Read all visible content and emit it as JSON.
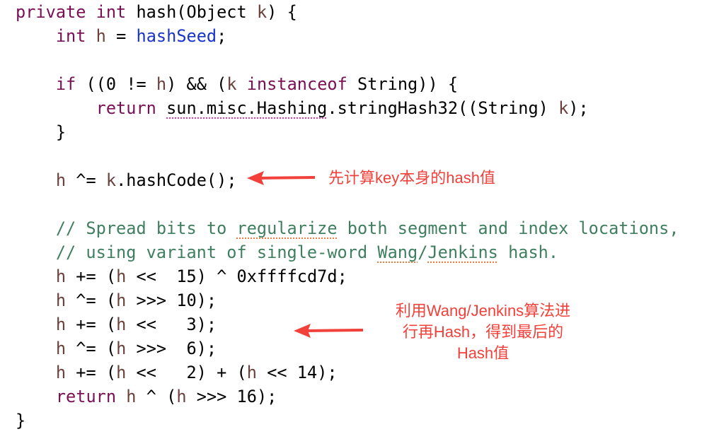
{
  "code": {
    "lines": [
      [
        {
          "t": "private int ",
          "c": "kw"
        },
        {
          "t": "hash(Object ",
          "c": ""
        },
        {
          "t": "k",
          "c": "var"
        },
        {
          "t": ") {",
          "c": ""
        }
      ],
      [
        {
          "t": "    ",
          "c": ""
        },
        {
          "t": "int ",
          "c": "kw"
        },
        {
          "t": "h",
          "c": "var"
        },
        {
          "t": " = ",
          "c": ""
        },
        {
          "t": "hashSeed",
          "c": "field"
        },
        {
          "t": ";",
          "c": ""
        }
      ],
      [],
      [
        {
          "t": "    ",
          "c": ""
        },
        {
          "t": "if ",
          "c": "kw"
        },
        {
          "t": "((0 != ",
          "c": ""
        },
        {
          "t": "h",
          "c": "var"
        },
        {
          "t": ") && (",
          "c": ""
        },
        {
          "t": "k ",
          "c": "var"
        },
        {
          "t": "instanceof ",
          "c": "kw"
        },
        {
          "t": "String)) {",
          "c": ""
        }
      ],
      [
        {
          "t": "        ",
          "c": ""
        },
        {
          "t": "return ",
          "c": "kw"
        },
        {
          "t": "sun.misc.Hashing",
          "c": "typo-pink"
        },
        {
          "t": ".stringHash32((String) ",
          "c": ""
        },
        {
          "t": "k",
          "c": "var"
        },
        {
          "t": ");",
          "c": ""
        }
      ],
      [
        {
          "t": "    }",
          "c": ""
        }
      ],
      [],
      [
        {
          "t": "    ",
          "c": ""
        },
        {
          "t": "h",
          "c": "var"
        },
        {
          "t": " ^= ",
          "c": ""
        },
        {
          "t": "k",
          "c": "var"
        },
        {
          "t": ".hashCode();",
          "c": ""
        }
      ],
      [],
      [
        {
          "t": "    // Spread bits to ",
          "c": "cm"
        },
        {
          "t": "regularize",
          "c": "cm typo-orange"
        },
        {
          "t": " both segment and index locations,",
          "c": "cm"
        }
      ],
      [
        {
          "t": "    // using variant of single-word ",
          "c": "cm"
        },
        {
          "t": "Wang",
          "c": "cm typo-orange"
        },
        {
          "t": "/",
          "c": "cm"
        },
        {
          "t": "Jenkins",
          "c": "cm typo-orange"
        },
        {
          "t": " hash.",
          "c": "cm"
        }
      ],
      [
        {
          "t": "    ",
          "c": ""
        },
        {
          "t": "h",
          "c": "var"
        },
        {
          "t": " += (",
          "c": ""
        },
        {
          "t": "h",
          "c": "var"
        },
        {
          "t": " <<  15) ^ 0xffffcd7d;",
          "c": ""
        }
      ],
      [
        {
          "t": "    ",
          "c": ""
        },
        {
          "t": "h",
          "c": "var"
        },
        {
          "t": " ^= (",
          "c": ""
        },
        {
          "t": "h",
          "c": "var"
        },
        {
          "t": " >>> 10);",
          "c": ""
        }
      ],
      [
        {
          "t": "    ",
          "c": ""
        },
        {
          "t": "h",
          "c": "var"
        },
        {
          "t": " += (",
          "c": ""
        },
        {
          "t": "h",
          "c": "var"
        },
        {
          "t": " <<   3);",
          "c": ""
        }
      ],
      [
        {
          "t": "    ",
          "c": ""
        },
        {
          "t": "h",
          "c": "var"
        },
        {
          "t": " ^= (",
          "c": ""
        },
        {
          "t": "h",
          "c": "var"
        },
        {
          "t": " >>>  6);",
          "c": ""
        }
      ],
      [
        {
          "t": "    ",
          "c": ""
        },
        {
          "t": "h",
          "c": "var"
        },
        {
          "t": " += (",
          "c": ""
        },
        {
          "t": "h",
          "c": "var"
        },
        {
          "t": " <<   2) + (",
          "c": ""
        },
        {
          "t": "h",
          "c": "var"
        },
        {
          "t": " << 14);",
          "c": ""
        }
      ],
      [
        {
          "t": "    ",
          "c": ""
        },
        {
          "t": "return ",
          "c": "kw"
        },
        {
          "t": "h",
          "c": "var"
        },
        {
          "t": " ^ (",
          "c": ""
        },
        {
          "t": "h",
          "c": "var"
        },
        {
          "t": " >>> 16);",
          "c": ""
        }
      ],
      [
        {
          "t": "}",
          "c": ""
        }
      ]
    ]
  },
  "annotations": {
    "first": {
      "text": "先计算key本身的hash值",
      "icon": "left-arrow-icon"
    },
    "second": {
      "lines": [
        "利用Wang/Jenkins算法进",
        "行再Hash，得到最后的",
        "Hash值"
      ],
      "icon": "left-arrow-icon"
    },
    "color": "#f2403a"
  }
}
